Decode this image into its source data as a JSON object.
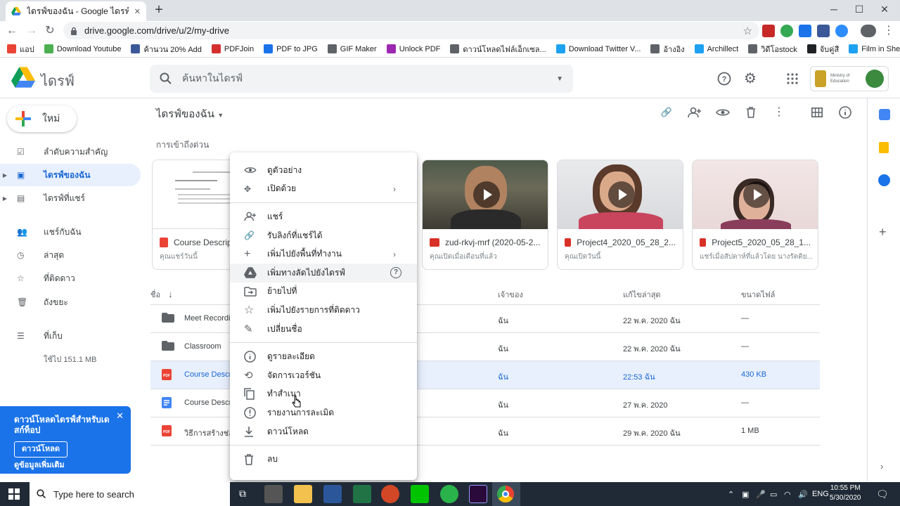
{
  "browser": {
    "tab_title": "ไดรฟ์ของฉัน - Google ไดรฟ์",
    "url": "drive.google.com/drive/u/2/my-drive",
    "bookmarks": [
      {
        "label": "แอป",
        "color": "#ea4335"
      },
      {
        "label": "Download Youtube",
        "color": "#4caf50"
      },
      {
        "label": "ค้านวน 20% Add",
        "color": "#3b5998"
      },
      {
        "label": "PDFJoin",
        "color": "#d32f2f"
      },
      {
        "label": "PDF to JPG",
        "color": "#1a73e8"
      },
      {
        "label": "GIF Maker",
        "color": "#5f6368"
      },
      {
        "label": "Unlock PDF",
        "color": "#9c27b0"
      },
      {
        "label": "ดาวน์โหลดไฟล์เอ็กเซล...",
        "color": "#5f6368"
      },
      {
        "label": "Download Twitter V...",
        "color": "#1da1f2"
      },
      {
        "label": "อ้างอิง",
        "color": "#5f6368"
      },
      {
        "label": "Archillect",
        "color": "#1da1f2"
      },
      {
        "label": "วิดีโอstock",
        "color": "#5f6368"
      },
      {
        "label": "จับคู่สี",
        "color": "#202124"
      },
      {
        "label": "Film in Shelf",
        "color": "#1da1f2"
      }
    ]
  },
  "drive": {
    "brand": "ไดรฟ์",
    "search_placeholder": "ค้นหาในไดรฟ์",
    "org_label": "Ministry of Education",
    "new_label": "ใหม่",
    "nav": [
      {
        "label": "ลำดับความสำคัญ"
      },
      {
        "label": "ไดรฟ์ของฉัน"
      },
      {
        "label": "ไดรฟ์ที่แชร์"
      },
      {
        "label": "แชร์กับฉัน"
      },
      {
        "label": "ล่าสุด"
      },
      {
        "label": "ที่ติดดาว"
      },
      {
        "label": "ถังขยะ"
      },
      {
        "label": "ที่เก็บ"
      }
    ],
    "storage": "ใช้ไป 151.1 MB",
    "promo": {
      "text": "ดาวน์โหลดไดรฟ์สำหรับเดสก์ท็อป",
      "download": "ดาวน์โหลด",
      "more": "ดูข้อมูลเพิ่มเติม"
    },
    "breadcrumb": "ไดรฟ์ของฉัน",
    "quick_access_title": "การเข้าถึงด่วน",
    "quick_access": [
      {
        "name": "Course Descrip",
        "sub": "คุณแชร์วันนี้"
      },
      {
        "name": "zud-rkvj-mrf (2020-05-2...",
        "sub": "คุณเปิดเมื่อเดือนที่แล้ว"
      },
      {
        "name": "Project4_2020_05_28_2...",
        "sub": "คุณเปิดวันนี้"
      },
      {
        "name": "Project5_2020_05_28_1...",
        "sub": "แชร์เมื่อสัปดาห์ที่แล้วโดย นางรัตติย..."
      }
    ],
    "columns": {
      "name": "ชื่อ",
      "owner": "เจ้าของ",
      "modified": "แก้ไขล่าสุด",
      "size": "ขนาดไฟล์"
    },
    "files": [
      {
        "name": "Meet Recordi",
        "owner": "ฉัน",
        "modified": "22 พ.ค. 2020 ฉัน",
        "size": "—"
      },
      {
        "name": "Classroom",
        "owner": "ฉัน",
        "modified": "22 พ.ค. 2020 ฉัน",
        "size": "—"
      },
      {
        "name": "Course Descr",
        "owner": "ฉัน",
        "modified": "22:53 ฉัน",
        "size": "430 KB"
      },
      {
        "name": "Course Descr",
        "owner": "ฉัน",
        "modified": "27 พ.ค. 2020",
        "size": "—"
      },
      {
        "name": "วิธีการสร้างช่อง",
        "owner": "ฉัน",
        "modified": "29 พ.ค. 2020 ฉัน",
        "size": "1 MB"
      }
    ]
  },
  "context_menu": [
    {
      "label": "ดูตัวอย่าง"
    },
    {
      "label": "เปิดด้วย"
    },
    {
      "label": "แชร์"
    },
    {
      "label": "รับลิงก์ที่แชร์ได้"
    },
    {
      "label": "เพิ่มไปยังพื้นที่ทำงาน"
    },
    {
      "label": "เพิ่มทางลัดไปยังไดรฟ์"
    },
    {
      "label": "ย้ายไปที่"
    },
    {
      "label": "เพิ่มไปยังรายการที่ติดดาว"
    },
    {
      "label": "เปลี่ยนชื่อ"
    },
    {
      "label": "ดูรายละเอียด"
    },
    {
      "label": "จัดการเวอร์ชัน"
    },
    {
      "label": "ทำสำเนา"
    },
    {
      "label": "รายงานการละเมิด"
    },
    {
      "label": "ดาวน์โหลด"
    },
    {
      "label": "ลบ"
    }
  ],
  "taskbar": {
    "search_placeholder": "Type here to search",
    "lang": "ENG",
    "time": "10:55 PM",
    "date": "5/30/2020"
  }
}
